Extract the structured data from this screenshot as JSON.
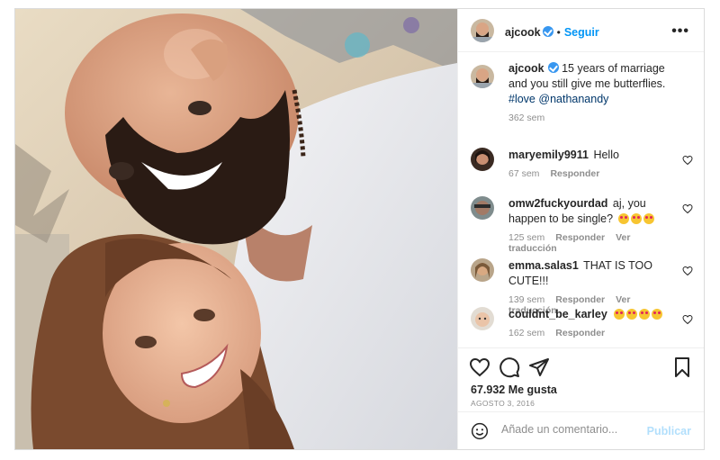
{
  "post": {
    "author": "ajcook",
    "follow_label": "Seguir",
    "dot": "•",
    "more_label": "•••",
    "caption": {
      "author": "ajcook",
      "text": "15 years of marriage and you still give me butterflies.",
      "hashtag": "#love",
      "mention": "@nathanandy",
      "time": "362 sem"
    },
    "comments": [
      {
        "user": "maryemily9911",
        "text": "Hello",
        "emojis": 0,
        "time": "67 sem",
        "reply": "Responder",
        "translate": ""
      },
      {
        "user": "omw2fuckyourdad",
        "text": "aj, you happen to be single?",
        "emojis": 3,
        "time": "125 sem",
        "reply": "Responder",
        "translate": "Ver traducción"
      },
      {
        "user": "emma.salas1",
        "text": "THAT IS TOO CUTE!!!",
        "emojis": 0,
        "time": "139 sem",
        "reply": "Responder",
        "translate": "Ver traducción"
      },
      {
        "user": "couldnt_be_karley",
        "text": "",
        "emojis": 4,
        "time": "162 sem",
        "reply": "Responder",
        "translate": ""
      }
    ],
    "likes": "67.932 Me gusta",
    "date": "AGOSTO 3, 2016",
    "comment_placeholder": "Añade un comentario...",
    "publish_label": "Publicar",
    "colors": {
      "accent": "#0095f6",
      "verified": "#3897f0",
      "muted": "#8e8e8e"
    },
    "icons": [
      "heart-icon",
      "comment-icon",
      "share-icon",
      "bookmark-icon",
      "emoji-icon",
      "verified-badge-icon",
      "more-options-icon"
    ]
  }
}
